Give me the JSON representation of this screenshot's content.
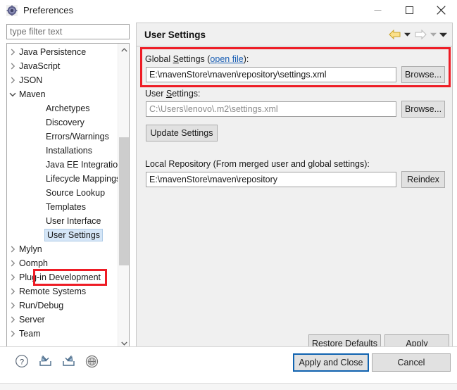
{
  "window": {
    "title": "Preferences",
    "icon": "preferences-gear-icon",
    "minimize_label": "Minimize",
    "maximize_label": "Maximize",
    "close_label": "Close"
  },
  "filter": {
    "placeholder": "type filter text",
    "value": ""
  },
  "tree": {
    "selected": "User Settings",
    "items": [
      {
        "label": "Java Persistence",
        "level": 0,
        "state": "collapsed"
      },
      {
        "label": "JavaScript",
        "level": 0,
        "state": "collapsed"
      },
      {
        "label": "JSON",
        "level": 0,
        "state": "collapsed"
      },
      {
        "label": "Maven",
        "level": 0,
        "state": "expanded"
      },
      {
        "label": "Archetypes",
        "level": 1,
        "state": "leaf"
      },
      {
        "label": "Discovery",
        "level": 1,
        "state": "leaf"
      },
      {
        "label": "Errors/Warnings",
        "level": 1,
        "state": "leaf"
      },
      {
        "label": "Installations",
        "level": 1,
        "state": "leaf"
      },
      {
        "label": "Java EE Integration",
        "level": 1,
        "state": "leaf"
      },
      {
        "label": "Lifecycle Mappings",
        "level": 1,
        "state": "leaf"
      },
      {
        "label": "Source Lookup",
        "level": 1,
        "state": "leaf"
      },
      {
        "label": "Templates",
        "level": 1,
        "state": "leaf"
      },
      {
        "label": "User Interface",
        "level": 1,
        "state": "leaf"
      },
      {
        "label": "User Settings",
        "level": 1,
        "state": "selected"
      },
      {
        "label": "Mylyn",
        "level": 0,
        "state": "collapsed"
      },
      {
        "label": "Oomph",
        "level": 0,
        "state": "collapsed"
      },
      {
        "label": "Plug-in Development",
        "level": 0,
        "state": "collapsed"
      },
      {
        "label": "Remote Systems",
        "level": 0,
        "state": "collapsed"
      },
      {
        "label": "Run/Debug",
        "level": 0,
        "state": "collapsed"
      },
      {
        "label": "Server",
        "level": 0,
        "state": "collapsed"
      },
      {
        "label": "Team",
        "level": 0,
        "state": "collapsed"
      }
    ]
  },
  "panel": {
    "title": "User Settings",
    "nav": {
      "back_label": "Back",
      "forward_label": "Forward",
      "menu_label": "View Menu"
    },
    "global_settings": {
      "label_prefix": "Global ",
      "label_mnemonic": "S",
      "label_suffix": "ettings (",
      "link": "open file",
      "label_end": "):",
      "value": "E:\\mavenStore\\maven\\repository\\settings.xml",
      "browse_label": "Browse..."
    },
    "user_settings": {
      "label_prefix": "User ",
      "label_mnemonic": "S",
      "label_suffix": "ettings:",
      "value": "C:\\Users\\lenovo\\.m2\\settings.xml",
      "browse_label": "Browse..."
    },
    "update_label": "Update Settings",
    "local_repository": {
      "label": "Local Repository (From merged user and global settings):",
      "value": "E:\\mavenStore\\maven\\repository",
      "reindex_label": "Reindex"
    },
    "restore_defaults_label": "Restore Defaults",
    "apply_label": "Apply"
  },
  "footer": {
    "icons": [
      {
        "name": "help-icon",
        "title": "Help"
      },
      {
        "name": "import-icon",
        "title": "Import Preferences"
      },
      {
        "name": "export-icon",
        "title": "Export Preferences"
      },
      {
        "name": "sphere-icon",
        "title": "Oomph Preference Recorder"
      }
    ],
    "apply_and_close_label": "Apply and Close",
    "cancel_label": "Cancel"
  },
  "colors": {
    "annotation": "#ee1c25",
    "selection": "#d5e6f7",
    "link": "#1a5fb4",
    "focus": "#1063b0",
    "panel_bg": "#f0f0f0"
  }
}
